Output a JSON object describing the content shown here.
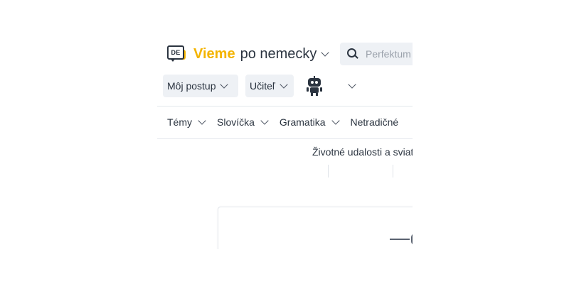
{
  "header": {
    "logo_text": "DE",
    "brand_name": "Vieme",
    "brand_lang": "po nemecky",
    "search": {
      "placeholder": "Perfektum",
      "value": ""
    }
  },
  "toolbar": {
    "progress_label": "Môj postup",
    "teacher_label": "Učiteľ"
  },
  "nav": {
    "items": [
      {
        "label": "Témy"
      },
      {
        "label": "Slovíčka"
      },
      {
        "label": "Gramatika"
      },
      {
        "label": "Netradičné"
      }
    ]
  },
  "content": {
    "topic_title": "Životné udalosti a sviatky"
  },
  "colors": {
    "brand": "#f4b400",
    "text": "#2b3440",
    "control_bg": "#eef1f5"
  }
}
